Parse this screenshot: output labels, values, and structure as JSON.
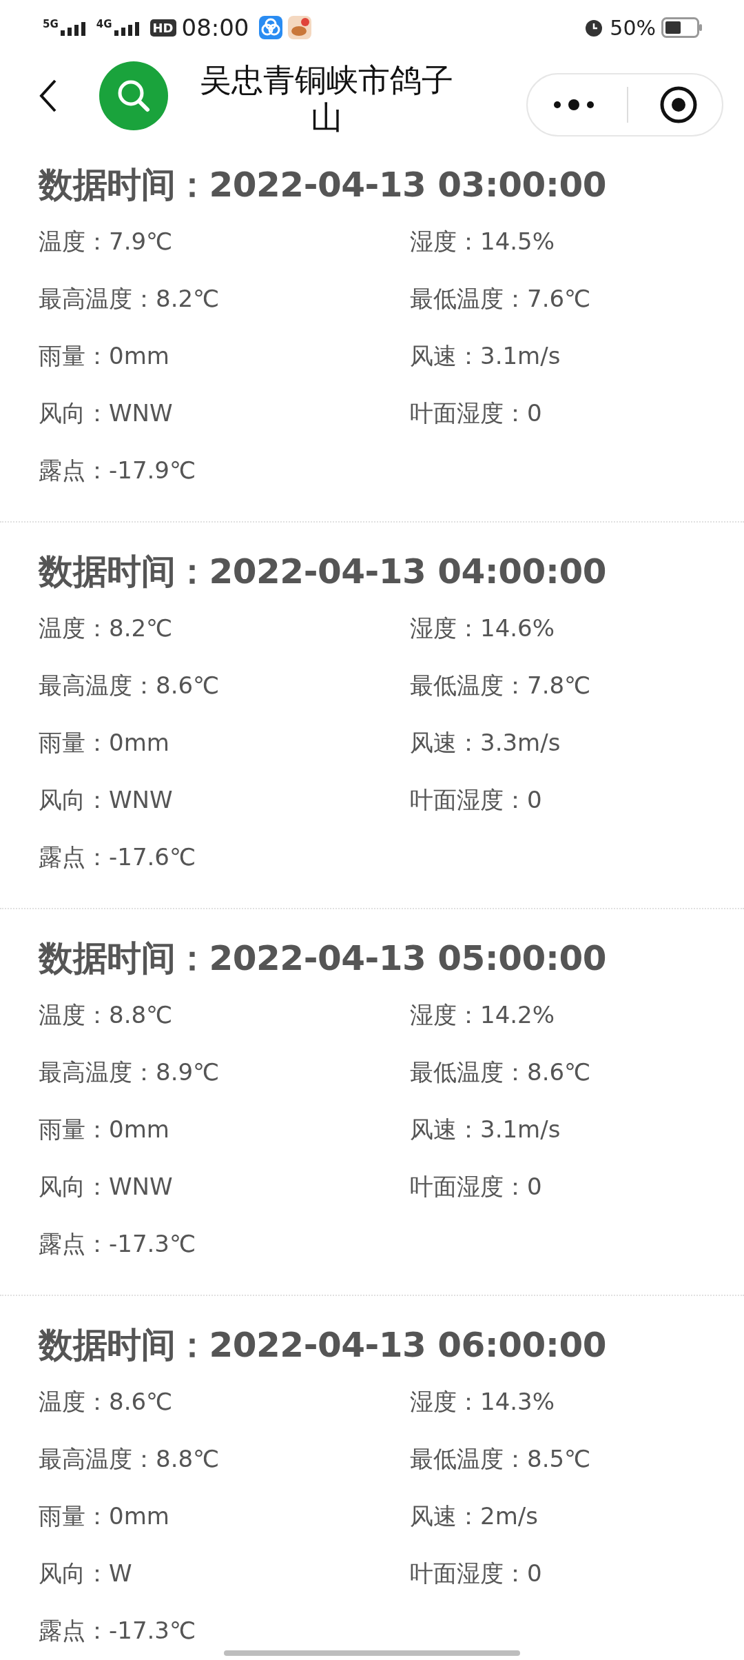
{
  "status_bar": {
    "signals": [
      "5G",
      "4G"
    ],
    "hd": "HD",
    "time": "08:00",
    "battery": "50%"
  },
  "header": {
    "title": "吴忠青铜峡市鸽子山"
  },
  "records": [
    {
      "heading": "数据时间：2022-04-13 03:00:00",
      "fields": [
        "温度：7.9℃",
        "湿度：14.5%",
        "最高温度：8.2℃",
        "最低温度：7.6℃",
        "雨量：0mm",
        "风速：3.1m/s",
        "风向：WNW",
        "叶面湿度：0",
        "露点：-17.9℃"
      ]
    },
    {
      "heading": "数据时间：2022-04-13 04:00:00",
      "fields": [
        "温度：8.2℃",
        "湿度：14.6%",
        "最高温度：8.6℃",
        "最低温度：7.8℃",
        "雨量：0mm",
        "风速：3.3m/s",
        "风向：WNW",
        "叶面湿度：0",
        "露点：-17.6℃"
      ]
    },
    {
      "heading": "数据时间：2022-04-13 05:00:00",
      "fields": [
        "温度：8.8℃",
        "湿度：14.2%",
        "最高温度：8.9℃",
        "最低温度：8.6℃",
        "雨量：0mm",
        "风速：3.1m/s",
        "风向：WNW",
        "叶面湿度：0",
        "露点：-17.3℃"
      ]
    },
    {
      "heading": "数据时间：2022-04-13 06:00:00",
      "fields": [
        "温度：8.6℃",
        "湿度：14.3%",
        "最高温度：8.8℃",
        "最低温度：8.5℃",
        "雨量：0mm",
        "风速：2m/s",
        "风向：W",
        "叶面湿度：0",
        "露点：-17.3℃"
      ]
    }
  ]
}
